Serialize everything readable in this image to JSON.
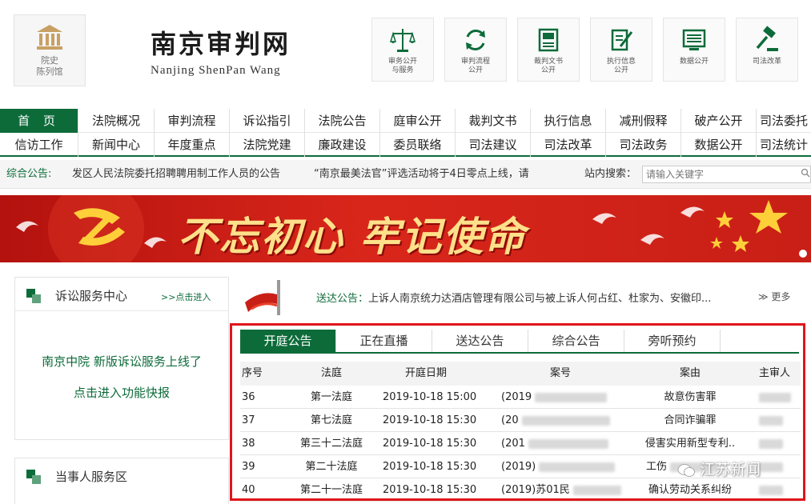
{
  "header": {
    "museum_label": "院史\n陈列馆",
    "logo_cn": "南京审判网",
    "logo_en": "Nanjing ShenPan Wang",
    "quick_links": [
      {
        "label": "审务公开\n与服务",
        "icon": "scales-icon"
      },
      {
        "label": "审判流程\n公开",
        "icon": "refresh-cycle-icon"
      },
      {
        "label": "裁判文书\n公开",
        "icon": "book-icon"
      },
      {
        "label": "执行信息\n公开",
        "icon": "document-pen-icon"
      },
      {
        "label": "数据公开",
        "icon": "data-screen-icon"
      },
      {
        "label": "司法改革",
        "icon": "gavel-icon"
      }
    ]
  },
  "nav": {
    "row1": [
      "首 页",
      "法院概况",
      "审判流程",
      "诉讼指引",
      "法院公告",
      "庭审公开",
      "裁判文书",
      "执行信息",
      "减刑假释",
      "破产公开",
      "司法委托"
    ],
    "row2": [
      "信访工作",
      "新闻中心",
      "年度重点",
      "法院党建",
      "廉政建设",
      "委员联络",
      "司法建议",
      "司法改革",
      "司法政务",
      "数据公开",
      "司法统计"
    ]
  },
  "notice": {
    "label": "综合公告:",
    "item1": "发区人民法院委托招聘聘用制工作人员的公告",
    "item2": "“南京最美法官”评选活动将于4日零点上线，请",
    "search_label": "站内搜索：",
    "search_placeholder": "请输入关键字"
  },
  "banner": {
    "slogan": "不忘初心 牢记使命"
  },
  "left": {
    "service_title": "诉讼服务中心",
    "service_more": ">>点击进入",
    "service_line1": "南京中院 新版诉讼服务上线了",
    "service_line2": "点击进入功能快报",
    "party_title": "当事人服务区"
  },
  "delivery": {
    "label": "送达公告：",
    "text": "上诉人南京统力达酒店管理有限公司与被上诉人何占红、杜家为、安徽印...",
    "more": "更多"
  },
  "tabs": [
    "开庭公告",
    "正在直播",
    "送达公告",
    "综合公告",
    "旁听预约"
  ],
  "table": {
    "headers": [
      "序号",
      "法庭",
      "开庭日期",
      "案号",
      "案由",
      "主审人"
    ],
    "rows": [
      {
        "no": "36",
        "court": "第一法庭",
        "date": "2019-10-18 15:00",
        "case": "(2019",
        "reason": "故意伤害罪"
      },
      {
        "no": "37",
        "court": "第七法庭",
        "date": "2019-10-18 15:30",
        "case": "(20",
        "reason": "合同诈骗罪"
      },
      {
        "no": "38",
        "court": "第三十二法庭",
        "date": "2019-10-18 15:30",
        "case": "(201",
        "reason": "侵害实用新型专利.."
      },
      {
        "no": "39",
        "court": "第二十法庭",
        "date": "2019-10-18 15:30",
        "case": "(2019)",
        "reason": "工伤"
      },
      {
        "no": "40",
        "court": "第二十一法庭",
        "date": "2019-10-18 15:30",
        "case": "(2019)苏01民",
        "reason": "确认劳动关系纠纷"
      }
    ]
  },
  "watermark": "江苏新闻",
  "colors": {
    "brand_green": "#0d6b3a",
    "banner_red": "#c81f16",
    "highlight_red": "#e0151a"
  }
}
